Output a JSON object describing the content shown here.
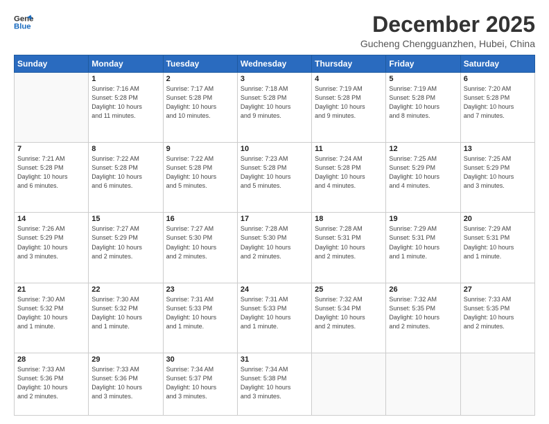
{
  "logo": {
    "line1": "General",
    "line2": "Blue"
  },
  "title": "December 2025",
  "location": "Gucheng Chengguanzhen, Hubei, China",
  "days_of_week": [
    "Sunday",
    "Monday",
    "Tuesday",
    "Wednesday",
    "Thursday",
    "Friday",
    "Saturday"
  ],
  "weeks": [
    [
      {
        "num": "",
        "info": ""
      },
      {
        "num": "1",
        "info": "Sunrise: 7:16 AM\nSunset: 5:28 PM\nDaylight: 10 hours\nand 11 minutes."
      },
      {
        "num": "2",
        "info": "Sunrise: 7:17 AM\nSunset: 5:28 PM\nDaylight: 10 hours\nand 10 minutes."
      },
      {
        "num": "3",
        "info": "Sunrise: 7:18 AM\nSunset: 5:28 PM\nDaylight: 10 hours\nand 9 minutes."
      },
      {
        "num": "4",
        "info": "Sunrise: 7:19 AM\nSunset: 5:28 PM\nDaylight: 10 hours\nand 9 minutes."
      },
      {
        "num": "5",
        "info": "Sunrise: 7:19 AM\nSunset: 5:28 PM\nDaylight: 10 hours\nand 8 minutes."
      },
      {
        "num": "6",
        "info": "Sunrise: 7:20 AM\nSunset: 5:28 PM\nDaylight: 10 hours\nand 7 minutes."
      }
    ],
    [
      {
        "num": "7",
        "info": "Sunrise: 7:21 AM\nSunset: 5:28 PM\nDaylight: 10 hours\nand 6 minutes."
      },
      {
        "num": "8",
        "info": "Sunrise: 7:22 AM\nSunset: 5:28 PM\nDaylight: 10 hours\nand 6 minutes."
      },
      {
        "num": "9",
        "info": "Sunrise: 7:22 AM\nSunset: 5:28 PM\nDaylight: 10 hours\nand 5 minutes."
      },
      {
        "num": "10",
        "info": "Sunrise: 7:23 AM\nSunset: 5:28 PM\nDaylight: 10 hours\nand 5 minutes."
      },
      {
        "num": "11",
        "info": "Sunrise: 7:24 AM\nSunset: 5:28 PM\nDaylight: 10 hours\nand 4 minutes."
      },
      {
        "num": "12",
        "info": "Sunrise: 7:25 AM\nSunset: 5:29 PM\nDaylight: 10 hours\nand 4 minutes."
      },
      {
        "num": "13",
        "info": "Sunrise: 7:25 AM\nSunset: 5:29 PM\nDaylight: 10 hours\nand 3 minutes."
      }
    ],
    [
      {
        "num": "14",
        "info": "Sunrise: 7:26 AM\nSunset: 5:29 PM\nDaylight: 10 hours\nand 3 minutes."
      },
      {
        "num": "15",
        "info": "Sunrise: 7:27 AM\nSunset: 5:29 PM\nDaylight: 10 hours\nand 2 minutes."
      },
      {
        "num": "16",
        "info": "Sunrise: 7:27 AM\nSunset: 5:30 PM\nDaylight: 10 hours\nand 2 minutes."
      },
      {
        "num": "17",
        "info": "Sunrise: 7:28 AM\nSunset: 5:30 PM\nDaylight: 10 hours\nand 2 minutes."
      },
      {
        "num": "18",
        "info": "Sunrise: 7:28 AM\nSunset: 5:31 PM\nDaylight: 10 hours\nand 2 minutes."
      },
      {
        "num": "19",
        "info": "Sunrise: 7:29 AM\nSunset: 5:31 PM\nDaylight: 10 hours\nand 1 minute."
      },
      {
        "num": "20",
        "info": "Sunrise: 7:29 AM\nSunset: 5:31 PM\nDaylight: 10 hours\nand 1 minute."
      }
    ],
    [
      {
        "num": "21",
        "info": "Sunrise: 7:30 AM\nSunset: 5:32 PM\nDaylight: 10 hours\nand 1 minute."
      },
      {
        "num": "22",
        "info": "Sunrise: 7:30 AM\nSunset: 5:32 PM\nDaylight: 10 hours\nand 1 minute."
      },
      {
        "num": "23",
        "info": "Sunrise: 7:31 AM\nSunset: 5:33 PM\nDaylight: 10 hours\nand 1 minute."
      },
      {
        "num": "24",
        "info": "Sunrise: 7:31 AM\nSunset: 5:33 PM\nDaylight: 10 hours\nand 1 minute."
      },
      {
        "num": "25",
        "info": "Sunrise: 7:32 AM\nSunset: 5:34 PM\nDaylight: 10 hours\nand 2 minutes."
      },
      {
        "num": "26",
        "info": "Sunrise: 7:32 AM\nSunset: 5:35 PM\nDaylight: 10 hours\nand 2 minutes."
      },
      {
        "num": "27",
        "info": "Sunrise: 7:33 AM\nSunset: 5:35 PM\nDaylight: 10 hours\nand 2 minutes."
      }
    ],
    [
      {
        "num": "28",
        "info": "Sunrise: 7:33 AM\nSunset: 5:36 PM\nDaylight: 10 hours\nand 2 minutes."
      },
      {
        "num": "29",
        "info": "Sunrise: 7:33 AM\nSunset: 5:36 PM\nDaylight: 10 hours\nand 3 minutes."
      },
      {
        "num": "30",
        "info": "Sunrise: 7:34 AM\nSunset: 5:37 PM\nDaylight: 10 hours\nand 3 minutes."
      },
      {
        "num": "31",
        "info": "Sunrise: 7:34 AM\nSunset: 5:38 PM\nDaylight: 10 hours\nand 3 minutes."
      },
      {
        "num": "",
        "info": ""
      },
      {
        "num": "",
        "info": ""
      },
      {
        "num": "",
        "info": ""
      }
    ]
  ]
}
